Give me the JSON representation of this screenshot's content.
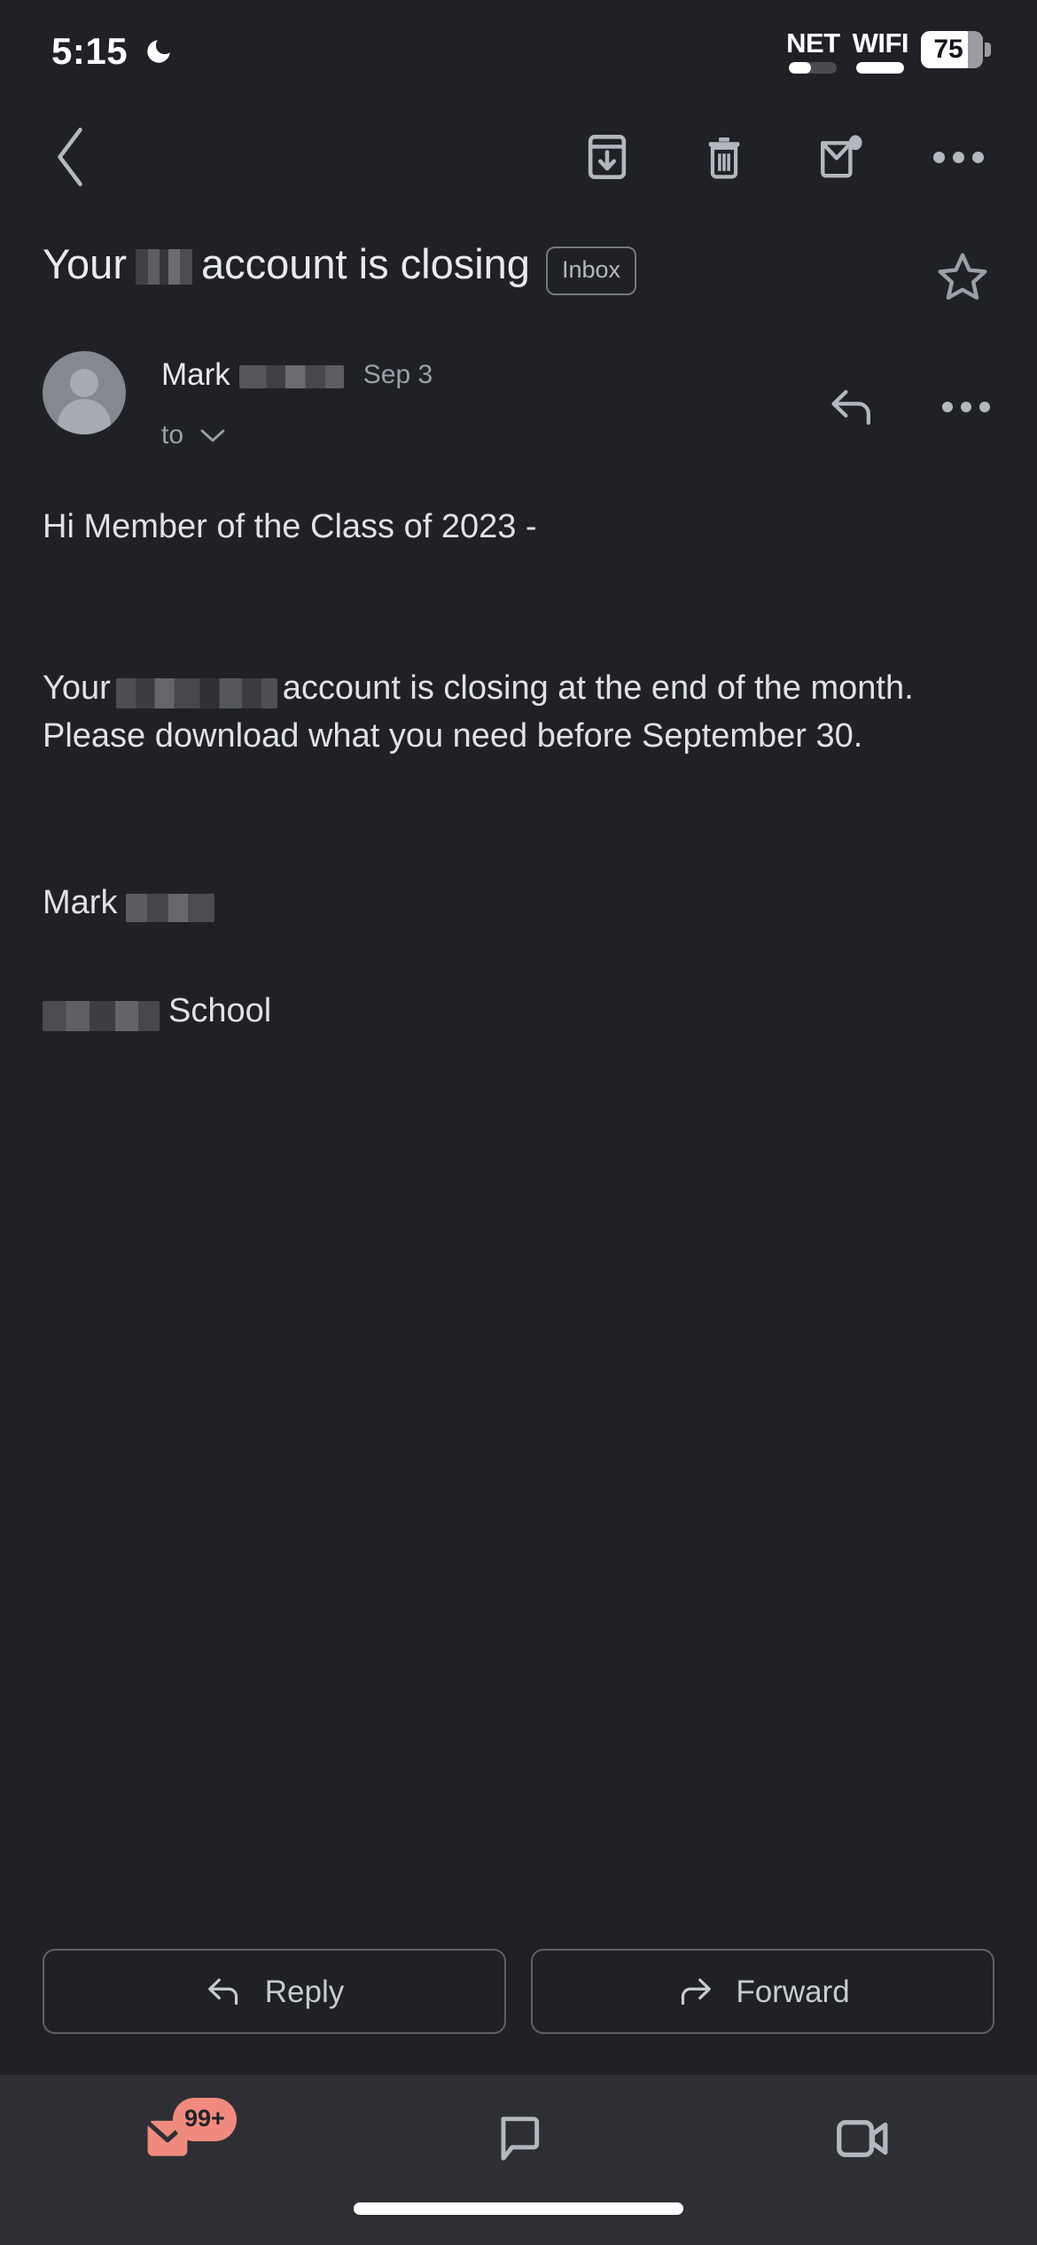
{
  "status_bar": {
    "time": "5:15",
    "dnd_icon": "moon-icon",
    "network_label": "NET",
    "wifi_label": "WIFI",
    "battery_percent": "75",
    "network_signal_pct": 45,
    "wifi_signal_pct": 100,
    "battery_fill_pct": 75
  },
  "toolbar": {
    "back_icon": "back-chevron-icon",
    "archive_icon": "archive-icon",
    "delete_icon": "trash-icon",
    "mark_unread_icon": "mark-unread-icon",
    "more_icon": "more-options-icon"
  },
  "email": {
    "subject_before": "Your",
    "subject_after": "account is closing",
    "label_chip": "Inbox",
    "star_icon": "star-outline-icon",
    "sender_name": "Mark",
    "date": "Sep 3",
    "recipients_label": "to",
    "expand_icon": "chevron-down-icon",
    "reply_icon": "reply-arrow-icon",
    "message_more_icon": "more-options-icon",
    "avatar_icon": "default-avatar-icon",
    "body": {
      "greeting": "Hi Member of the Class of 2023 -",
      "paragraph_before": "Your",
      "paragraph_after": "account is closing at the end of the month. Please download what you need before September 30.",
      "signature_name": "Mark",
      "signature_org_suffix": "School"
    }
  },
  "actions": {
    "reply_label": "Reply",
    "reply_icon": "reply-arrow-icon",
    "forward_label": "Forward",
    "forward_icon": "forward-arrow-icon"
  },
  "bottom_nav": {
    "items": [
      {
        "name": "mail",
        "icon": "mail-icon",
        "badge": "99+",
        "active": true
      },
      {
        "name": "chat",
        "icon": "chat-bubble-icon",
        "badge": "",
        "active": false
      },
      {
        "name": "meet",
        "icon": "video-camera-icon",
        "badge": "",
        "active": false
      }
    ]
  },
  "colors": {
    "background": "#202126",
    "nav_background": "#2e2f34",
    "accent": "#F08A7E",
    "text_primary": "#e8eaed",
    "text_secondary": "#9aa0a6",
    "icon": "#b4b7bd"
  }
}
